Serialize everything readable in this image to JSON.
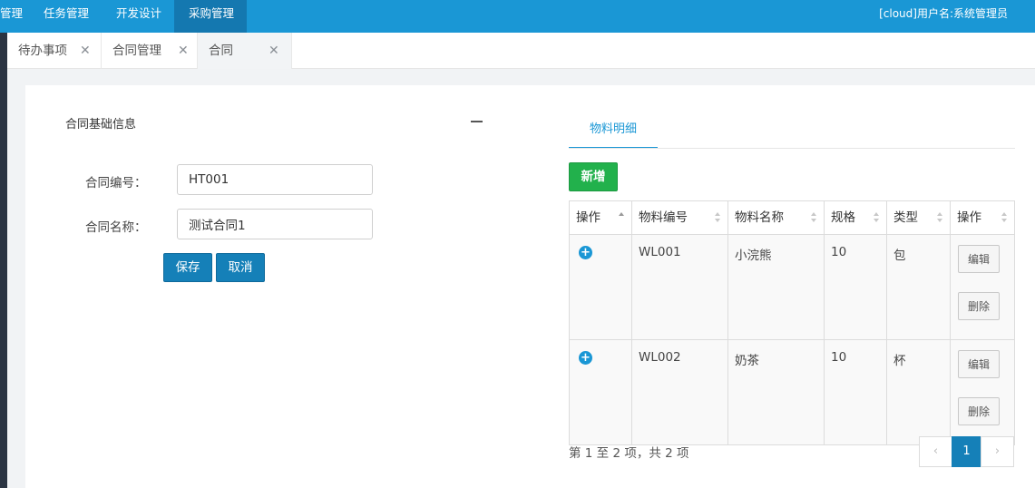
{
  "topnav": {
    "items": [
      {
        "label": "管理",
        "active": false
      },
      {
        "label": "任务管理",
        "active": false
      },
      {
        "label": "开发设计",
        "active": false
      },
      {
        "label": "采购管理",
        "active": true
      }
    ],
    "user": "[cloud]用户名:系统管理员"
  },
  "tabs": [
    {
      "label": "待办事项",
      "close": "✕"
    },
    {
      "label": "合同管理",
      "close": "✕"
    },
    {
      "label": "合同",
      "close": "✕"
    }
  ],
  "form": {
    "section_title": "合同基础信息",
    "fields": [
      {
        "label": "合同编号：",
        "value": "HT001"
      },
      {
        "label": "合同名称：",
        "value": "测试合同1"
      }
    ],
    "save_label": "保存",
    "cancel_label": "取消"
  },
  "materials": {
    "tab_label": "物料明细",
    "add_label": "新增",
    "columns": [
      "操作",
      "物料编号",
      "物料名称",
      "规格",
      "类型",
      "操作"
    ],
    "rows": [
      {
        "code": "WL001",
        "name": "小浣熊",
        "spec": "10",
        "type": "包"
      },
      {
        "code": "WL002",
        "name": "奶茶",
        "spec": "10",
        "type": "杯"
      }
    ],
    "row_actions": {
      "expand": "+",
      "edit": "编辑",
      "delete": "删除"
    },
    "page_info": "第 1 至 2 项，共 2 项",
    "pager": {
      "prev": "‹",
      "current": "1",
      "next": "›"
    }
  },
  "colors": {
    "nav": "#1a97d5",
    "nav_active": "#1478b0",
    "primary": "#1580b8",
    "success": "#22b14c"
  }
}
